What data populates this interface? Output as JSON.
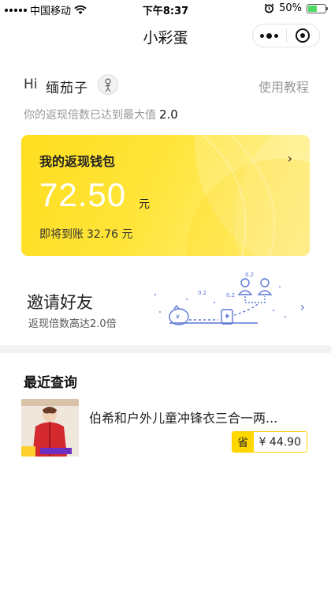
{
  "status_bar": {
    "carrier": "中国移动",
    "time": "下午8:37",
    "battery": "50%",
    "battery_level": 0.5
  },
  "navbar": {
    "title": "小彩蛋"
  },
  "greeting": {
    "hi": "Hi",
    "name": "缅茄子",
    "tutorial": "使用教程",
    "multiplier_text": "你的返现倍数已达到最大值",
    "multiplier_value": "2.0"
  },
  "wallet": {
    "title": "我的返现钱包",
    "amount": "72.50",
    "unit": "元",
    "pending_label": "即将到账",
    "pending_amount": "32.76 元"
  },
  "invite": {
    "title": "邀请好友",
    "subtitle": "返现倍数高达2.0倍",
    "bubble_1": "0.2",
    "bubble_2": "0.2",
    "bubble_3": "0.2",
    "coin_symbol": "¥"
  },
  "recent": {
    "title": "最近查询",
    "items": [
      {
        "title": "伯希和户外儿童冲锋衣三合一两...",
        "save_label": "省",
        "price": "¥ 44.90"
      }
    ]
  },
  "colors": {
    "accent_yellow": "#ffde1f",
    "invite_blue": "#5b76d6",
    "battery_green": "#4cd964"
  }
}
